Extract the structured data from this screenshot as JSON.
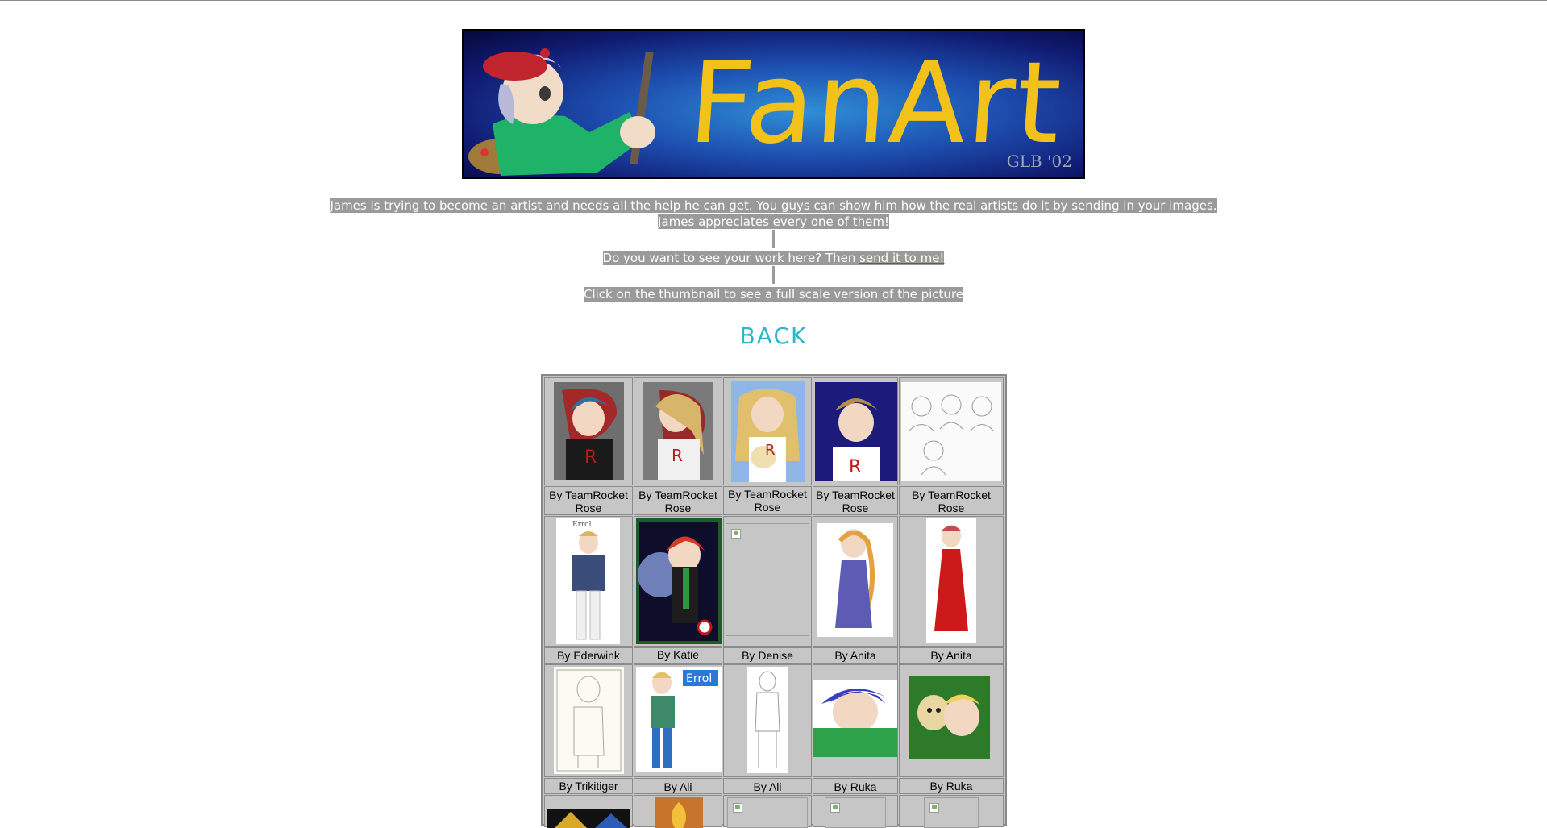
{
  "banner": {
    "title": "FanArt",
    "signature": "GLB '02"
  },
  "intro": {
    "line1": "James is trying to become an artist and needs all the help he can get. You guys can show him how the real artists do it by sending in your images.",
    "line2": "James appreciates every one of them!",
    "submit_prefix": "Do you want to see your work here? Then ",
    "submit_link": "send it to me!",
    "instructions": "Click on the thumbnail to see a full scale version of the picture"
  },
  "back_label": "BACK",
  "gallery": {
    "row1": [
      "By TeamRocket Rose",
      "By TeamRocket Rose",
      "By TeamRocket Rose",
      "By TeamRocket Rose",
      "By TeamRocket Rose"
    ],
    "row2": [
      "By Ederwink",
      "By Katie Hayward",
      "By Denise",
      "By Anita",
      "By Anita"
    ],
    "row3": [
      "By Trikitiger",
      "By Ali",
      "By Ali",
      "By Ruka",
      "By Ruka"
    ]
  },
  "thumbnail_labels": {
    "errol_sketch": "Errol",
    "errol_color": "Errol"
  }
}
